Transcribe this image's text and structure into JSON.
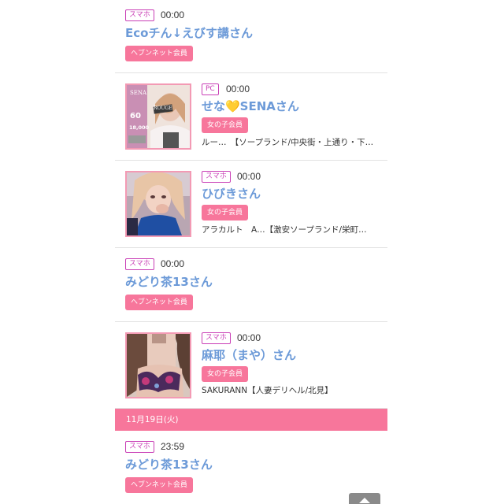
{
  "entries": [
    {
      "device": "スマホ",
      "time": "00:00",
      "name": "Ecoチん↓えびす講さん",
      "member": "ヘブンネット会員",
      "shop": ""
    },
    {
      "device": "PC",
      "time": "00:00",
      "name": "せな💛SENAさん",
      "member": "女の子会員",
      "shop": "ルー…　【ソープランド/中央街・上通り・下…",
      "thumb_text": [
        "SENA",
        "ROUGE",
        "60",
        "18,000"
      ]
    },
    {
      "device": "スマホ",
      "time": "00:00",
      "name": "ひびきさん",
      "member": "女の子会員",
      "shop": "アラカルト　A…【激安ソープランド/栄町…"
    },
    {
      "device": "スマホ",
      "time": "00:00",
      "name": "みどり茶13さん",
      "member": "ヘブンネット会員",
      "shop": ""
    },
    {
      "device": "スマホ",
      "time": "00:00",
      "name": "麻耶（まや）さん",
      "member": "女の子会員",
      "shop": "SAKURANN【人妻デリヘル/北見】"
    }
  ],
  "date_divider": "11月19日(火)",
  "after_divider": {
    "device": "スマホ",
    "time": "23:59",
    "name": "みどり茶13さん",
    "member": "ヘブンネット会員"
  },
  "colors": {
    "accent_pink": "#f7769b",
    "badge_border": "#c93fb6",
    "name_blue": "#6c9ad8",
    "side_strip": "#fde3e8"
  },
  "icons": {
    "scroll_top": "chevron-up-icon"
  }
}
